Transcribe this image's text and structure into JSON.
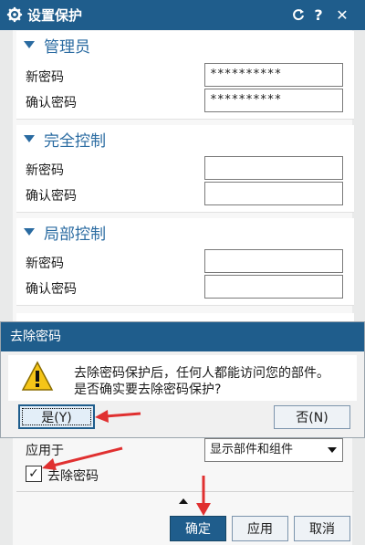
{
  "dialog": {
    "title": "设置保护",
    "icons": [
      "gear-icon",
      "reset-icon",
      "help-icon",
      "close-icon"
    ]
  },
  "sections": {
    "admin": {
      "title": "管理员",
      "new_label": "新密码",
      "confirm_label": "确认密码",
      "new_value": "**********",
      "confirm_value": "**********"
    },
    "full": {
      "title": "完全控制",
      "new_label": "新密码",
      "confirm_label": "确认密码",
      "new_value": "",
      "confirm_value": ""
    },
    "partial": {
      "title": "局部控制",
      "new_label": "新密码",
      "confirm_label": "确认密码",
      "new_value": "",
      "confirm_value": ""
    }
  },
  "message_box": {
    "title": "去除密码",
    "line1": "去除密码保护后，任何人都能访问您的部件。",
    "line2": "是否确实要去除密码保护?",
    "yes_label": "是(Y)",
    "no_label": "否(N)"
  },
  "apply_to": {
    "label": "应用于",
    "value": "显示部件和组件"
  },
  "remove_password": {
    "label": "去除密码",
    "checked": true
  },
  "footer": {
    "ok": "确定",
    "apply": "应用",
    "cancel": "取消"
  },
  "colors": {
    "title_bar": "#1f5d8c",
    "accent": "#2a6ba1",
    "arrow": "#e03030"
  }
}
